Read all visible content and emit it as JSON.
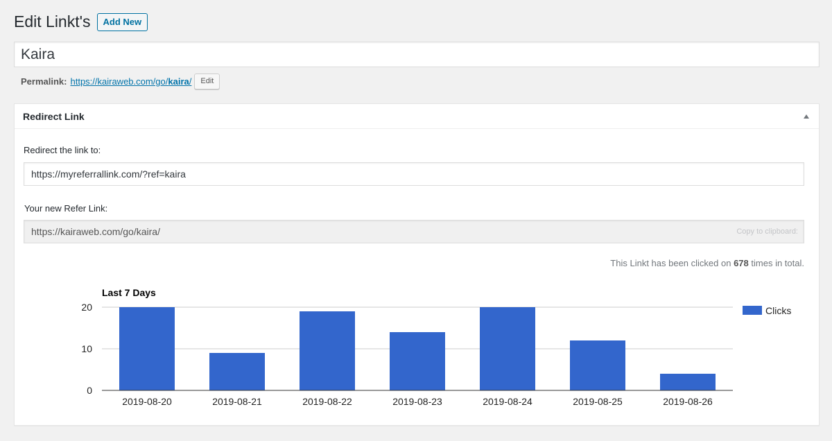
{
  "header": {
    "title": "Edit Linkt's",
    "add_new": "Add New"
  },
  "post_title": "Kaira",
  "permalink": {
    "label": "Permalink:",
    "url_prefix": "https://kairaweb.com/go/",
    "slug": "kaira",
    "url_suffix": "/",
    "edit_label": "Edit"
  },
  "panel": {
    "title": "Redirect Link",
    "redirect_label": "Redirect the link to:",
    "redirect_value": "https://myreferrallink.com/?ref=kaira",
    "refer_label": "Your new Refer Link:",
    "refer_value": "https://kairaweb.com/go/kaira/",
    "copy_label": "Copy to clipboard:",
    "clicks_prefix": "This Linkt has been clicked on",
    "clicks_count": "678",
    "clicks_suffix": "times in total."
  },
  "chart_data": {
    "type": "bar",
    "title": "Last 7 Days",
    "categories": [
      "2019-08-20",
      "2019-08-21",
      "2019-08-22",
      "2019-08-23",
      "2019-08-24",
      "2019-08-25",
      "2019-08-26"
    ],
    "series": [
      {
        "name": "Clicks",
        "values": [
          20,
          9,
          19,
          14,
          20,
          12,
          4
        ]
      }
    ],
    "yticks": [
      0,
      10,
      20
    ],
    "ylim": [
      0,
      20
    ],
    "legend": "right",
    "grid": true,
    "color": "#3366cc"
  }
}
